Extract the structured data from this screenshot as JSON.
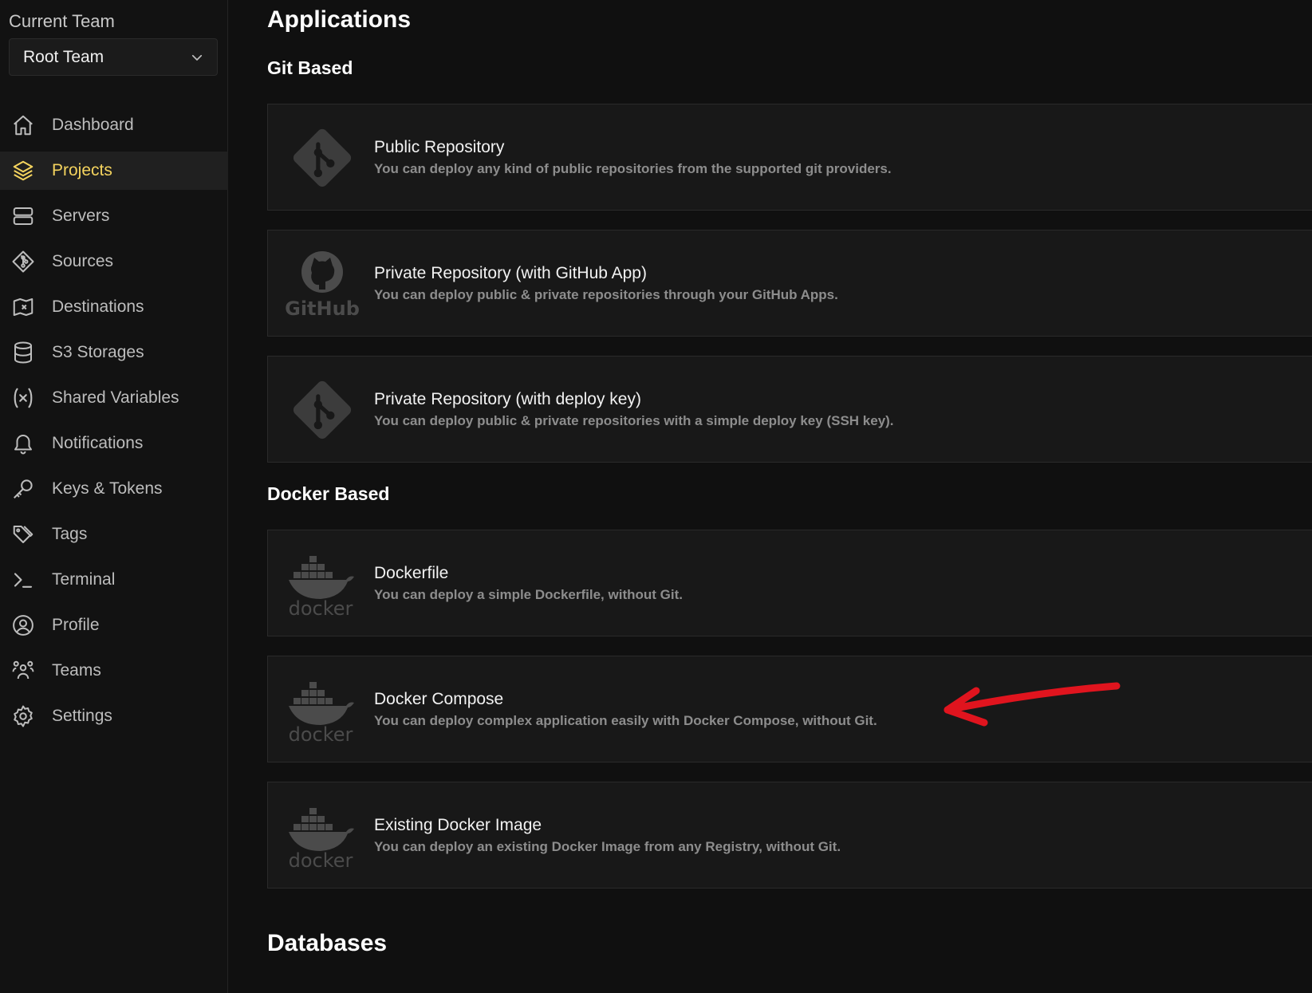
{
  "sidebar": {
    "team_label": "Current Team",
    "team_value": "Root Team",
    "items": [
      {
        "label": "Dashboard",
        "icon": "home-icon"
      },
      {
        "label": "Projects",
        "icon": "layers-icon",
        "active": true
      },
      {
        "label": "Servers",
        "icon": "server-icon"
      },
      {
        "label": "Sources",
        "icon": "git-icon"
      },
      {
        "label": "Destinations",
        "icon": "map-icon"
      },
      {
        "label": "S3 Storages",
        "icon": "database-icon"
      },
      {
        "label": "Shared Variables",
        "icon": "variable-icon"
      },
      {
        "label": "Notifications",
        "icon": "bell-icon"
      },
      {
        "label": "Keys & Tokens",
        "icon": "key-icon"
      },
      {
        "label": "Tags",
        "icon": "tags-icon"
      },
      {
        "label": "Terminal",
        "icon": "terminal-icon"
      },
      {
        "label": "Profile",
        "icon": "user-circle-icon"
      },
      {
        "label": "Teams",
        "icon": "users-icon"
      },
      {
        "label": "Settings",
        "icon": "gear-icon"
      }
    ]
  },
  "main": {
    "title": "Applications",
    "git_section": "Git Based",
    "docker_section": "Docker Based",
    "databases_title": "Databases",
    "git_cards": [
      {
        "title": "Public Repository",
        "desc": "You can deploy any kind of public repositories from the supported git providers.",
        "logo": "git-logo-icon"
      },
      {
        "title": "Private Repository (with GitHub App)",
        "desc": "You can deploy public & private repositories through your GitHub Apps.",
        "logo": "github-logo-icon",
        "logo_text": "GitHub"
      },
      {
        "title": "Private Repository (with deploy key)",
        "desc": "You can deploy public & private repositories with a simple deploy key (SSH key).",
        "logo": "git-logo-icon"
      }
    ],
    "docker_cards": [
      {
        "title": "Dockerfile",
        "desc": "You can deploy a simple Dockerfile, without Git.",
        "logo": "docker-logo-icon",
        "logo_text": "docker"
      },
      {
        "title": "Docker Compose",
        "desc": "You can deploy complex application easily with Docker Compose, without Git.",
        "logo": "docker-logo-icon",
        "logo_text": "docker"
      },
      {
        "title": "Existing Docker Image",
        "desc": "You can deploy an existing Docker Image from any Registry, without Git.",
        "logo": "docker-logo-icon",
        "logo_text": "docker"
      }
    ]
  },
  "colors": {
    "background": "#101010",
    "card": "#181818",
    "accent_active": "#f4d35e",
    "annotation_arrow": "#e0141e"
  }
}
